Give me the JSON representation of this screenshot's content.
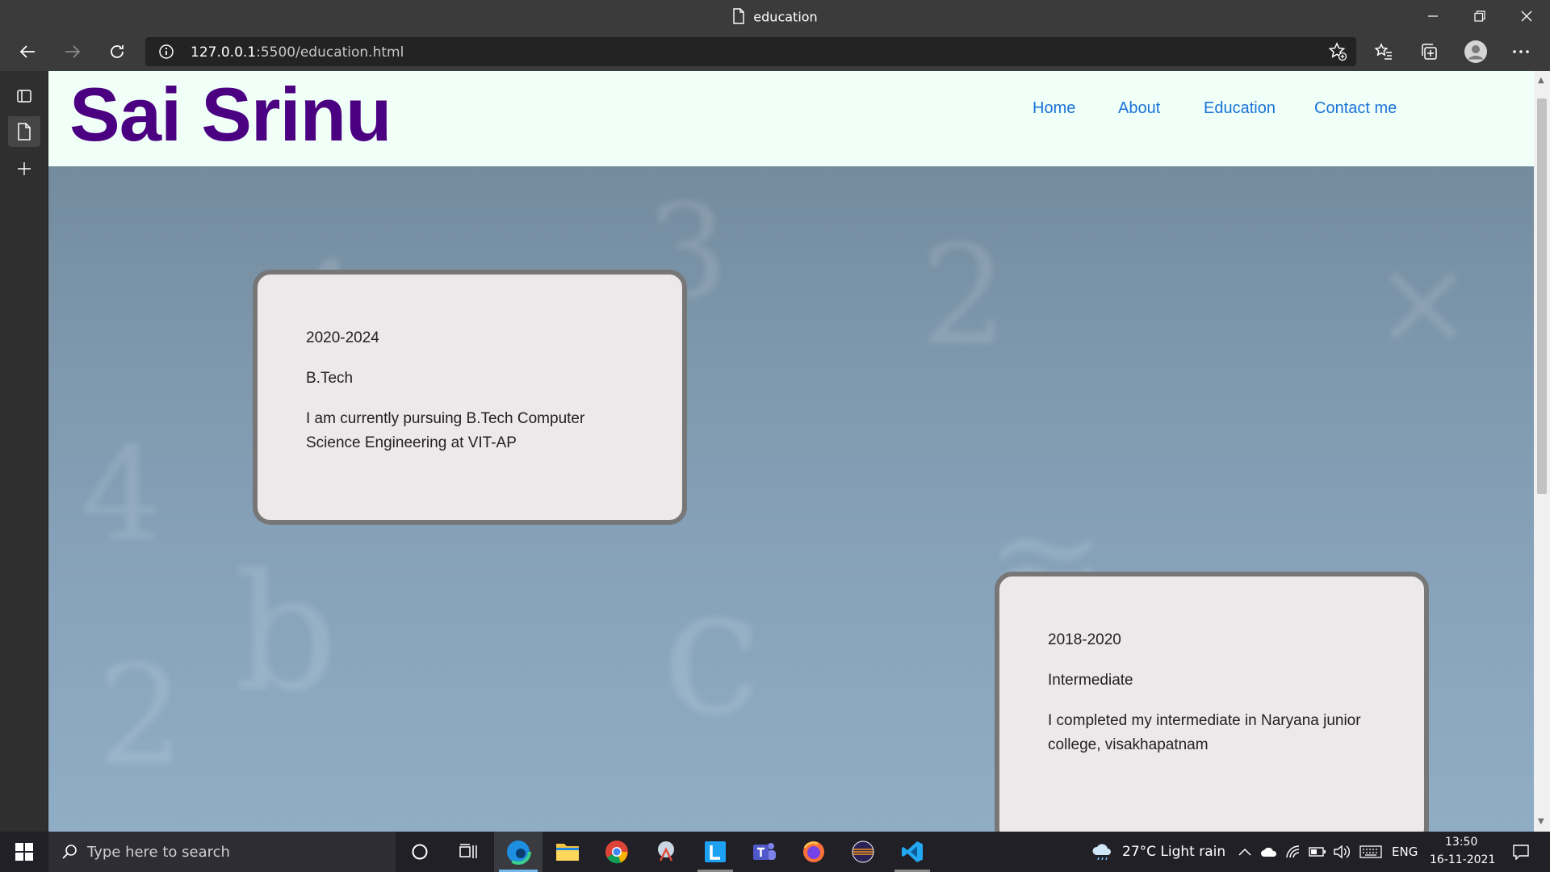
{
  "browser": {
    "window_title": "education",
    "url_host": "127.0.0.1",
    "url_rest": ":5500/education.html"
  },
  "site": {
    "logo": "Sai Srinu",
    "nav": [
      "Home",
      "About",
      "Education",
      "Contact me"
    ],
    "nav_color": "#1a73d9",
    "logo_color": "#4b0082"
  },
  "education": [
    {
      "years": "2020-2024",
      "degree": "B.Tech",
      "description": "I am currently pursuing B.Tech Computer Science Engineering at VIT-AP"
    },
    {
      "years": "2018-2020",
      "degree": "Intermediate",
      "description": "I completed my intermediate in Naryana junior college, visakhapatnam"
    }
  ],
  "taskbar": {
    "search_placeholder": "Type here to search",
    "weather": "27°C  Light rain",
    "language": "ENG",
    "time": "13:50",
    "date": "16-11-2021"
  }
}
